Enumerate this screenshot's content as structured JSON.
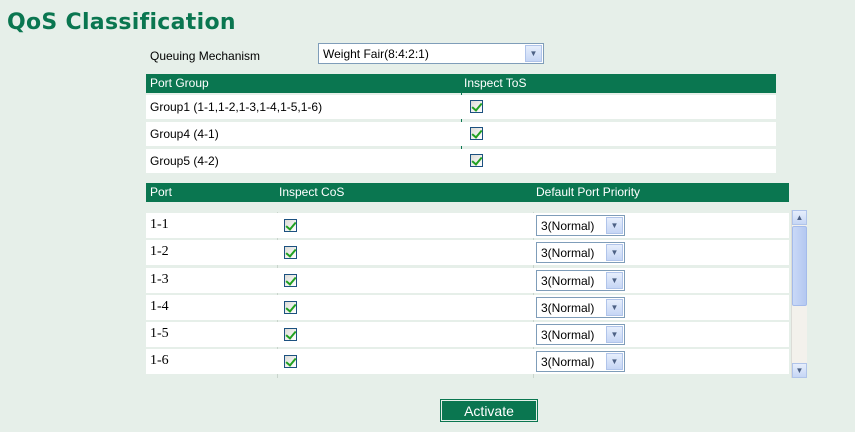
{
  "title": "QoS Classification",
  "queuing": {
    "label": "Queuing Mechanism",
    "value": "Weight Fair(8:4:2:1)"
  },
  "group_table": {
    "headers": [
      "Port Group",
      "Inspect ToS"
    ],
    "rows": [
      {
        "group": "Group1 (1-1,1-2,1-3,1-4,1-5,1-6)",
        "inspect_tos": true
      },
      {
        "group": "Group4 (4-1)",
        "inspect_tos": true
      },
      {
        "group": "Group5 (4-2)",
        "inspect_tos": true
      }
    ]
  },
  "port_table": {
    "headers": [
      "Port",
      "Inspect CoS",
      "Default Port Priority"
    ],
    "rows": [
      {
        "port": "1-1",
        "inspect_cos": true,
        "priority": "3(Normal)"
      },
      {
        "port": "1-2",
        "inspect_cos": true,
        "priority": "3(Normal)"
      },
      {
        "port": "1-3",
        "inspect_cos": true,
        "priority": "3(Normal)"
      },
      {
        "port": "1-4",
        "inspect_cos": true,
        "priority": "3(Normal)"
      },
      {
        "port": "1-5",
        "inspect_cos": true,
        "priority": "3(Normal)"
      },
      {
        "port": "1-6",
        "inspect_cos": true,
        "priority": "3(Normal)"
      }
    ]
  },
  "activate_label": "Activate",
  "colors": {
    "accent": "#0a7650",
    "background": "#e6efe9"
  },
  "icons": {
    "dropdown": "chevron-down-icon",
    "checkbox": "checkmark-icon"
  }
}
